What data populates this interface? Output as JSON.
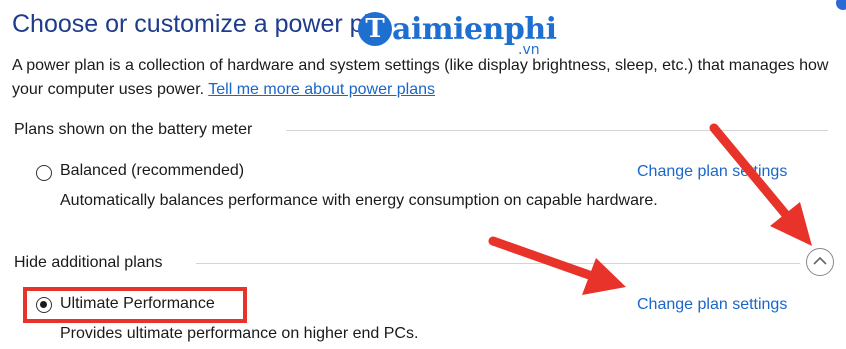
{
  "header": {
    "title": "Choose or customize a power pla",
    "watermark": {
      "letter": "T",
      "name": "aimienphi",
      "tld": ".vn"
    }
  },
  "description": {
    "text": "A power plan is a collection of hardware and system settings (like display brightness, sleep, etc.) that manages how your computer uses power.",
    "link": "Tell me more about power plans"
  },
  "battery_section": {
    "label": "Plans shown on the battery meter",
    "plans": [
      {
        "name": "Balanced (recommended)",
        "selected": false,
        "description": "Automatically balances performance with energy consumption on capable hardware.",
        "link": "Change plan settings"
      }
    ]
  },
  "additional_section": {
    "label": "Hide additional plans",
    "toggle_icon": "chevron-up-icon",
    "plans": [
      {
        "name": "Ultimate Performance",
        "selected": true,
        "description": "Provides ultimate performance on higher end PCs.",
        "link": "Change plan settings"
      }
    ]
  },
  "colors": {
    "title": "#1e3c8c",
    "link": "#1a66c9",
    "annotation_red": "#e8332a",
    "watermark_blue": "#1f6fd1"
  }
}
